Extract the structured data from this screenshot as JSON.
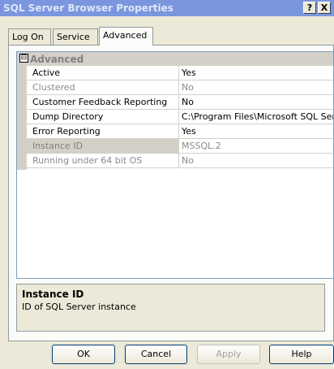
{
  "window": {
    "title": "SQL Server Browser Properties",
    "help_button": "?",
    "close_button": "X"
  },
  "tabs": [
    {
      "label": "Log On"
    },
    {
      "label": "Service"
    },
    {
      "label": "Advanced"
    }
  ],
  "grid": {
    "category": "Advanced",
    "expander": "⊟",
    "rows": [
      {
        "name": "Active",
        "value": "Yes",
        "enabled": true
      },
      {
        "name": "Clustered",
        "value": "No",
        "enabled": false
      },
      {
        "name": "Customer Feedback Reporting",
        "value": "No",
        "enabled": true
      },
      {
        "name": "Dump Directory",
        "value": "C:\\Program Files\\Microsoft SQL Serv",
        "enabled": true
      },
      {
        "name": "Error Reporting",
        "value": "Yes",
        "enabled": true
      },
      {
        "name": "Instance ID",
        "value": "MSSQL.2",
        "enabled": false,
        "selected": true
      },
      {
        "name": "Running under 64 bit OS",
        "value": "No",
        "enabled": false
      }
    ]
  },
  "description": {
    "title": "Instance ID",
    "text": "ID of SQL Server instance"
  },
  "buttons": {
    "ok": "OK",
    "cancel": "Cancel",
    "apply": "Apply",
    "help": "Help"
  }
}
